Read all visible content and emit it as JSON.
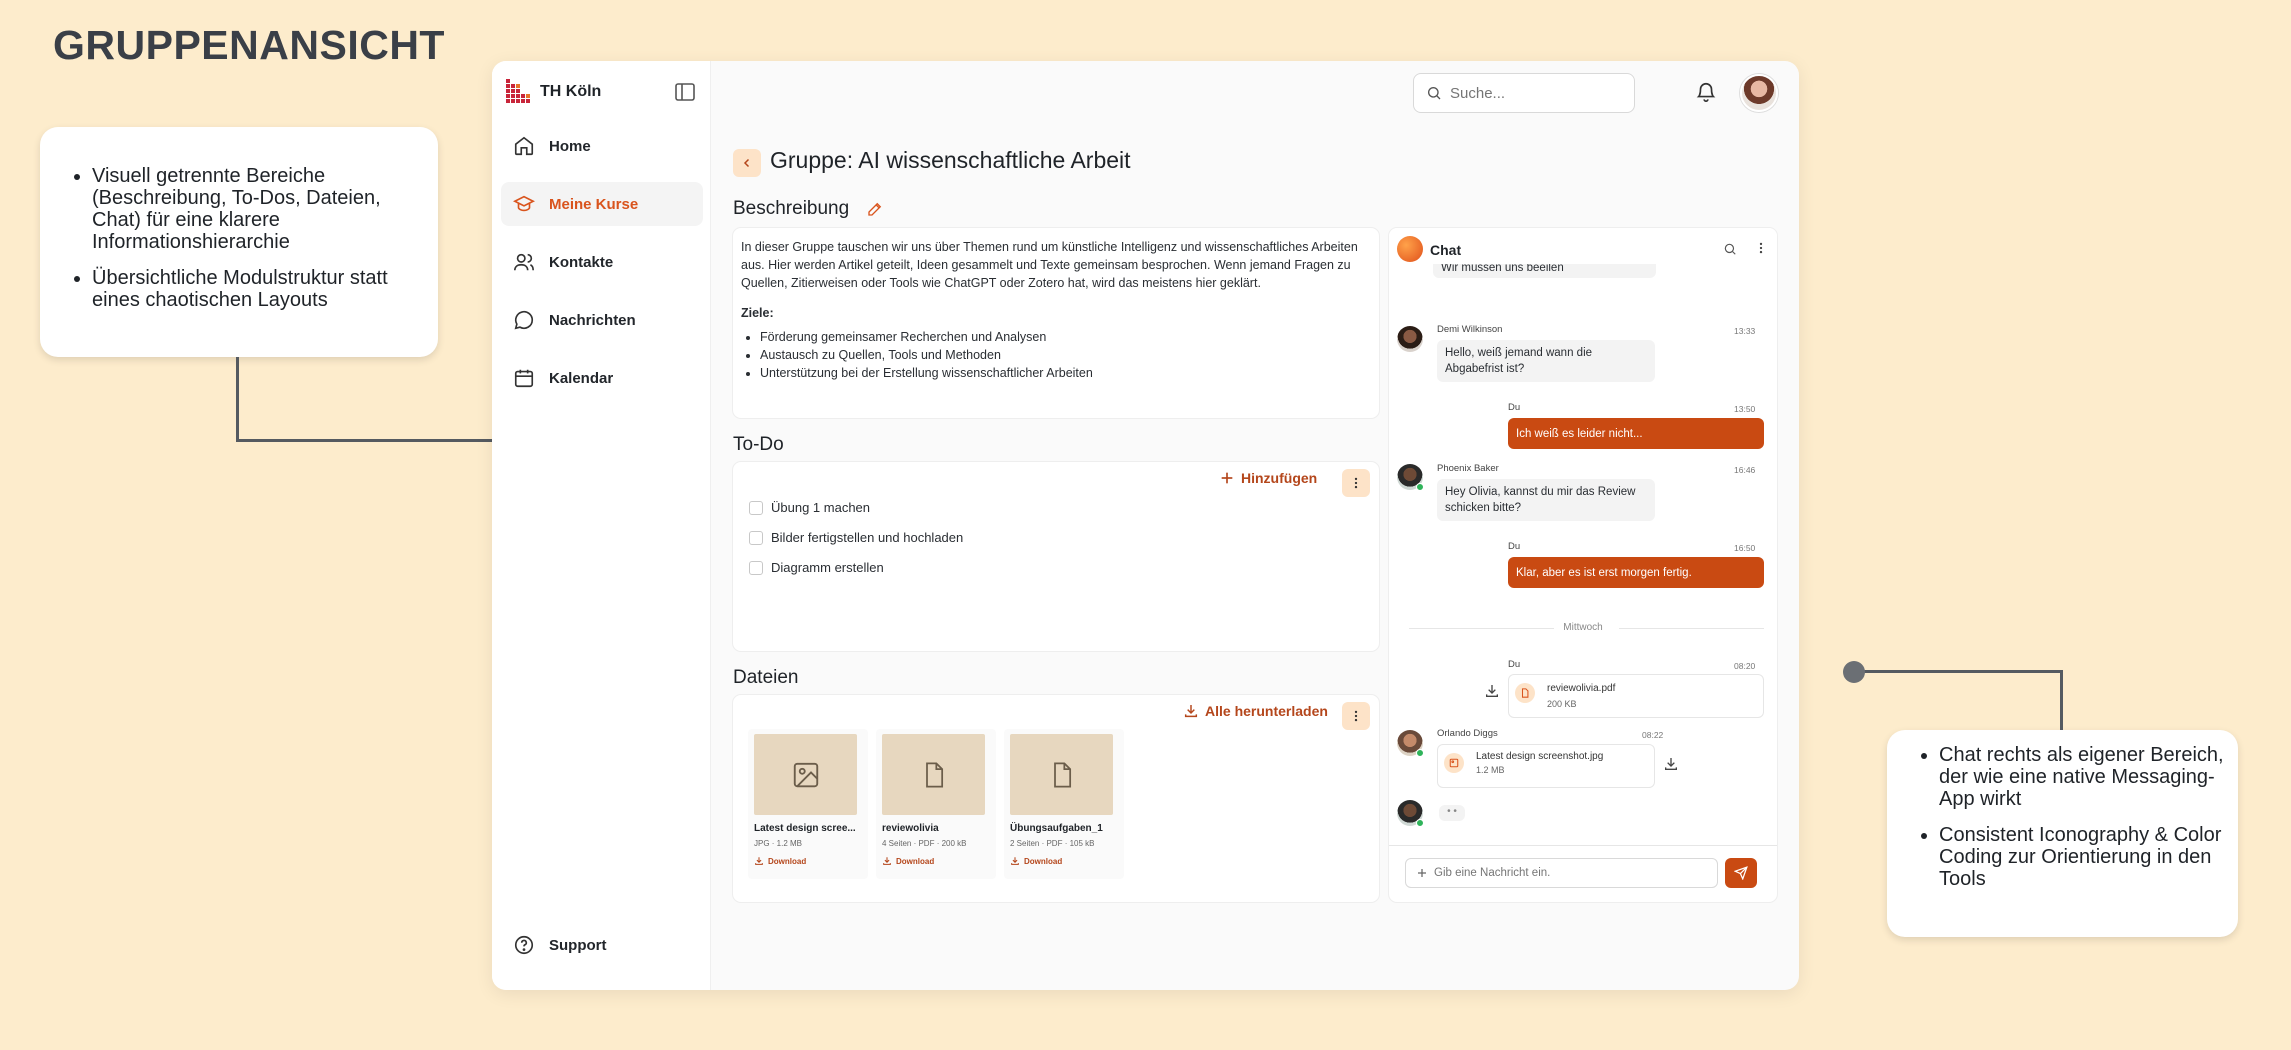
{
  "heading": "GRUPPENANSICHT",
  "callouts": {
    "left": [
      "Visuell getrennte Bereiche (Beschreibung, To-Dos, Dateien, Chat) für eine klarere Informationshierarchie",
      "Übersichtliche Modulstruktur statt eines chaotischen Layouts"
    ],
    "right": [
      "Chat rechts als eigener Bereich, der wie eine native Messaging-App wirkt",
      "Consistent Iconography & Color Coding zur Orientierung in den Tools"
    ]
  },
  "brand": {
    "name": "TH Köln"
  },
  "nav": [
    {
      "label": "Home",
      "icon": "home-icon"
    },
    {
      "label": "Meine Kurse",
      "icon": "graduation-cap-icon",
      "active": true
    },
    {
      "label": "Kontakte",
      "icon": "users-icon"
    },
    {
      "label": "Nachrichten",
      "icon": "message-circle-icon"
    },
    {
      "label": "Kalendar",
      "icon": "calendar-icon"
    }
  ],
  "support": {
    "label": "Support"
  },
  "search": {
    "placeholder": "Suche..."
  },
  "group": {
    "title": "Gruppe: AI wissenschaftliche Arbeit"
  },
  "description": {
    "title": "Beschreibung",
    "text": "In dieser Gruppe tauschen wir uns über Themen rund um künstliche Intelligenz und wissenschaftliches Arbeiten aus. Hier werden Artikel geteilt, Ideen gesammelt und Texte gemeinsam besprochen. Wenn jemand Fragen zu Quellen, Zitierweisen oder Tools wie ChatGPT oder Zotero hat, wird das meistens hier geklärt.",
    "goals_label": "Ziele:",
    "goals": [
      "Förderung gemeinsamer Recherchen und Analysen",
      "Austausch zu Quellen, Tools und Methoden",
      "Unterstützung bei der Erstellung wissenschaftlicher Arbeiten"
    ]
  },
  "todo": {
    "title": "To-Do",
    "add_label": "Hinzufügen",
    "items": [
      "Übung 1 machen",
      "Bilder fertigstellen und hochladen",
      "Diagramm erstellen"
    ]
  },
  "files": {
    "title": "Dateien",
    "download_all_label": "Alle herunterladen",
    "items": [
      {
        "name": "Latest design scree...",
        "meta": "JPG · 1.2 MB",
        "download": "Download",
        "icon": "image-icon"
      },
      {
        "name": "reviewolivia",
        "meta": "4 Seiten · PDF · 200 kB",
        "download": "Download",
        "icon": "file-icon"
      },
      {
        "name": "Übungsaufgaben_1",
        "meta": "2 Seiten · PDF · 105 kB",
        "download": "Download",
        "icon": "file-icon"
      }
    ]
  },
  "chat": {
    "title": "Chat",
    "messages": {
      "m0": "Wir müssen uns beeilen",
      "m1": {
        "name": "Demi Wilkinson",
        "time": "13:33",
        "text": "Hello, weiß jemand wann die Abgabefrist ist?"
      },
      "m2": {
        "name": "Du",
        "time": "13:50",
        "text": "Ich weiß es leider nicht..."
      },
      "m3": {
        "name": "Phoenix Baker",
        "time": "16:46",
        "text": "Hey Olivia, kannst du mir das Review schicken bitte?"
      },
      "m4": {
        "name": "Du",
        "time": "16:50",
        "text": "Klar, aber es ist erst morgen fertig."
      },
      "divider": "Mittwoch",
      "m5": {
        "name": "Du",
        "time": "08:20",
        "file": "reviewolivia.pdf",
        "size": "200 KB"
      },
      "m6": {
        "name": "Orlando Diggs",
        "time": "08:22",
        "file": "Latest design screenshot.jpg",
        "size": "1.2 MB"
      },
      "typing": "• •"
    },
    "input_placeholder": "Gib eine Nachricht ein."
  },
  "colors": {
    "accent": "#c94a12",
    "accent_soft": "#fde3c8",
    "background": "#fdeccc"
  }
}
